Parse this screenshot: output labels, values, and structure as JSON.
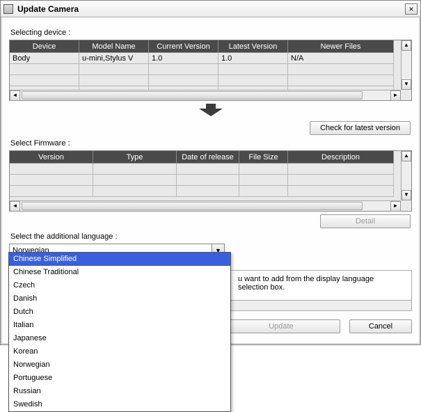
{
  "window": {
    "title": "Update Camera"
  },
  "device_section": {
    "label": "Selecting device :",
    "headers": [
      "Device",
      "Model Name",
      "Current Version",
      "Latest Version",
      "Newer Files"
    ],
    "rows": [
      {
        "device": "Body",
        "model": "u-mini,Stylus V",
        "current": "1.0",
        "latest": "1.0",
        "newer": "N/A"
      }
    ],
    "check_button": "Check for latest version"
  },
  "firmware_section": {
    "label": "Select Firmware :",
    "headers": [
      "Version",
      "Type",
      "Date of release",
      "File Size",
      "Description"
    ],
    "detail_button": "Detail"
  },
  "language_section": {
    "label": "Select the additional language :",
    "selected": "Norwegian",
    "highlighted": "Chinese Simplified",
    "options": [
      "Chinese Simplified",
      "Chinese Traditional",
      "Czech",
      "Danish",
      "Dutch",
      "Italian",
      "Japanese",
      "Korean",
      "Norwegian",
      "Portuguese",
      "Russian",
      "Swedish"
    ]
  },
  "info_text": "u want to add from the display language selection box.",
  "actions": {
    "update": "Update",
    "cancel": "Cancel"
  }
}
